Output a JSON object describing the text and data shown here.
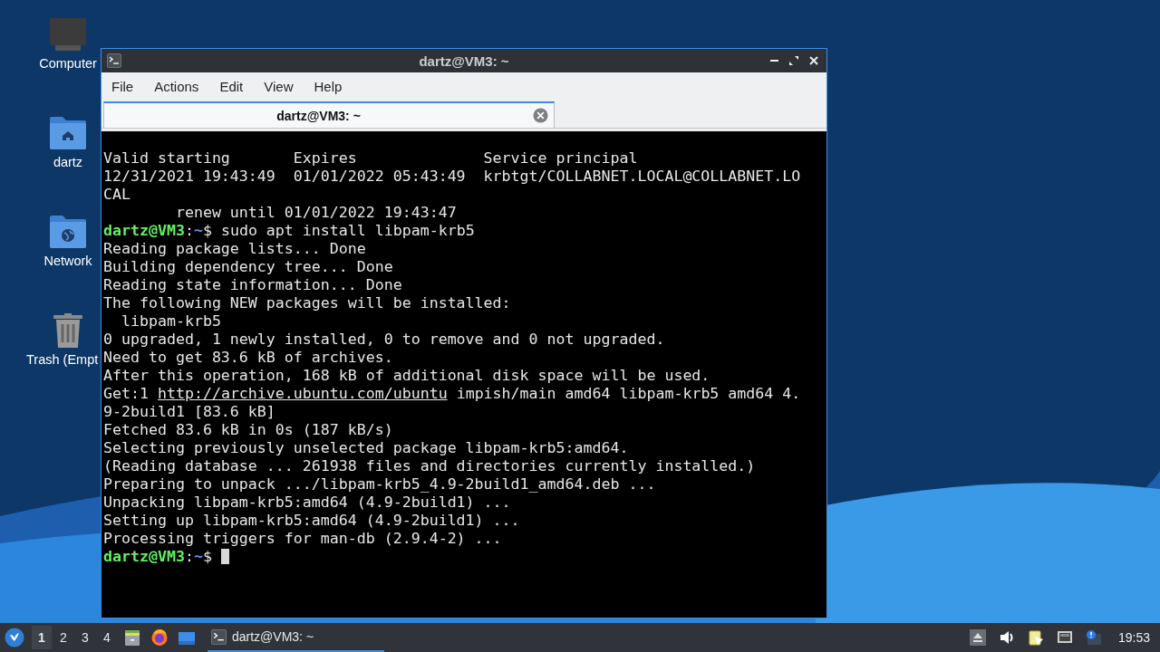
{
  "desktop_icons": [
    {
      "kind": "computer",
      "label": "Computer"
    },
    {
      "kind": "home",
      "label": "dartz"
    },
    {
      "kind": "network",
      "label": "Network"
    },
    {
      "kind": "trash",
      "label": "Trash (Empt"
    }
  ],
  "window": {
    "title": "dartz@VM3: ~",
    "menu": [
      "File",
      "Actions",
      "Edit",
      "View",
      "Help"
    ],
    "tabs": [
      {
        "label": "dartz@VM3: ~",
        "selected": true
      }
    ],
    "terminal": {
      "lines": [
        {
          "kind": "text",
          "text": "Valid starting       Expires              Service principal"
        },
        {
          "kind": "text",
          "text": "12/31/2021 19:43:49  01/01/2022 05:43:49  krbtgt/COLLABNET.LOCAL@COLLABNET.LO"
        },
        {
          "kind": "text",
          "text": "CAL"
        },
        {
          "kind": "text",
          "text": "        renew until 01/01/2022 19:43:47"
        },
        {
          "kind": "prompt",
          "user": "dartz@VM3",
          "sep": ":",
          "path": "~",
          "symbol": "$",
          "command": " sudo apt install libpam-krb5",
          "cursor": false
        },
        {
          "kind": "text",
          "text": "Reading package lists... Done"
        },
        {
          "kind": "text",
          "text": "Building dependency tree... Done"
        },
        {
          "kind": "text",
          "text": "Reading state information... Done"
        },
        {
          "kind": "text",
          "text": "The following NEW packages will be installed:"
        },
        {
          "kind": "text",
          "text": "  libpam-krb5"
        },
        {
          "kind": "text",
          "text": "0 upgraded, 1 newly installed, 0 to remove and 0 not upgraded."
        },
        {
          "kind": "text",
          "text": "Need to get 83.6 kB of archives."
        },
        {
          "kind": "text",
          "text": "After this operation, 168 kB of additional disk space will be used."
        },
        {
          "kind": "link",
          "before": "Get:1 ",
          "link": "http://archive.ubuntu.com/ubuntu",
          "after": " impish/main amd64 libpam-krb5 amd64 4."
        },
        {
          "kind": "text",
          "text": "9-2build1 [83.6 kB]"
        },
        {
          "kind": "text",
          "text": "Fetched 83.6 kB in 0s (187 kB/s)"
        },
        {
          "kind": "text",
          "text": "Selecting previously unselected package libpam-krb5:amd64."
        },
        {
          "kind": "text",
          "text": "(Reading database ... 261938 files and directories currently installed.)"
        },
        {
          "kind": "text",
          "text": "Preparing to unpack .../libpam-krb5_4.9-2build1_amd64.deb ..."
        },
        {
          "kind": "text",
          "text": "Unpacking libpam-krb5:amd64 (4.9-2build1) ..."
        },
        {
          "kind": "text",
          "text": "Setting up libpam-krb5:amd64 (4.9-2build1) ..."
        },
        {
          "kind": "text",
          "text": "Processing triggers for man-db (2.9.4-2) ..."
        },
        {
          "kind": "prompt",
          "user": "dartz@VM3",
          "sep": ":",
          "path": "~",
          "symbol": "$",
          "cursor": true
        }
      ]
    }
  },
  "taskbar": {
    "workspaces": [
      {
        "label": "1",
        "selected": true
      },
      {
        "label": "2",
        "selected": false
      },
      {
        "label": "3",
        "selected": false
      },
      {
        "label": "4",
        "selected": false
      }
    ],
    "launchers": [
      {
        "kind": "files"
      },
      {
        "kind": "browser"
      },
      {
        "kind": "desktop"
      }
    ],
    "tasks": [
      {
        "label": "dartz@VM3: ~",
        "selected": true
      }
    ],
    "tray": [
      {
        "kind": "eject"
      },
      {
        "kind": "volume"
      },
      {
        "kind": "clipboard"
      },
      {
        "kind": "network"
      },
      {
        "kind": "update"
      }
    ],
    "clock": "19:53"
  }
}
